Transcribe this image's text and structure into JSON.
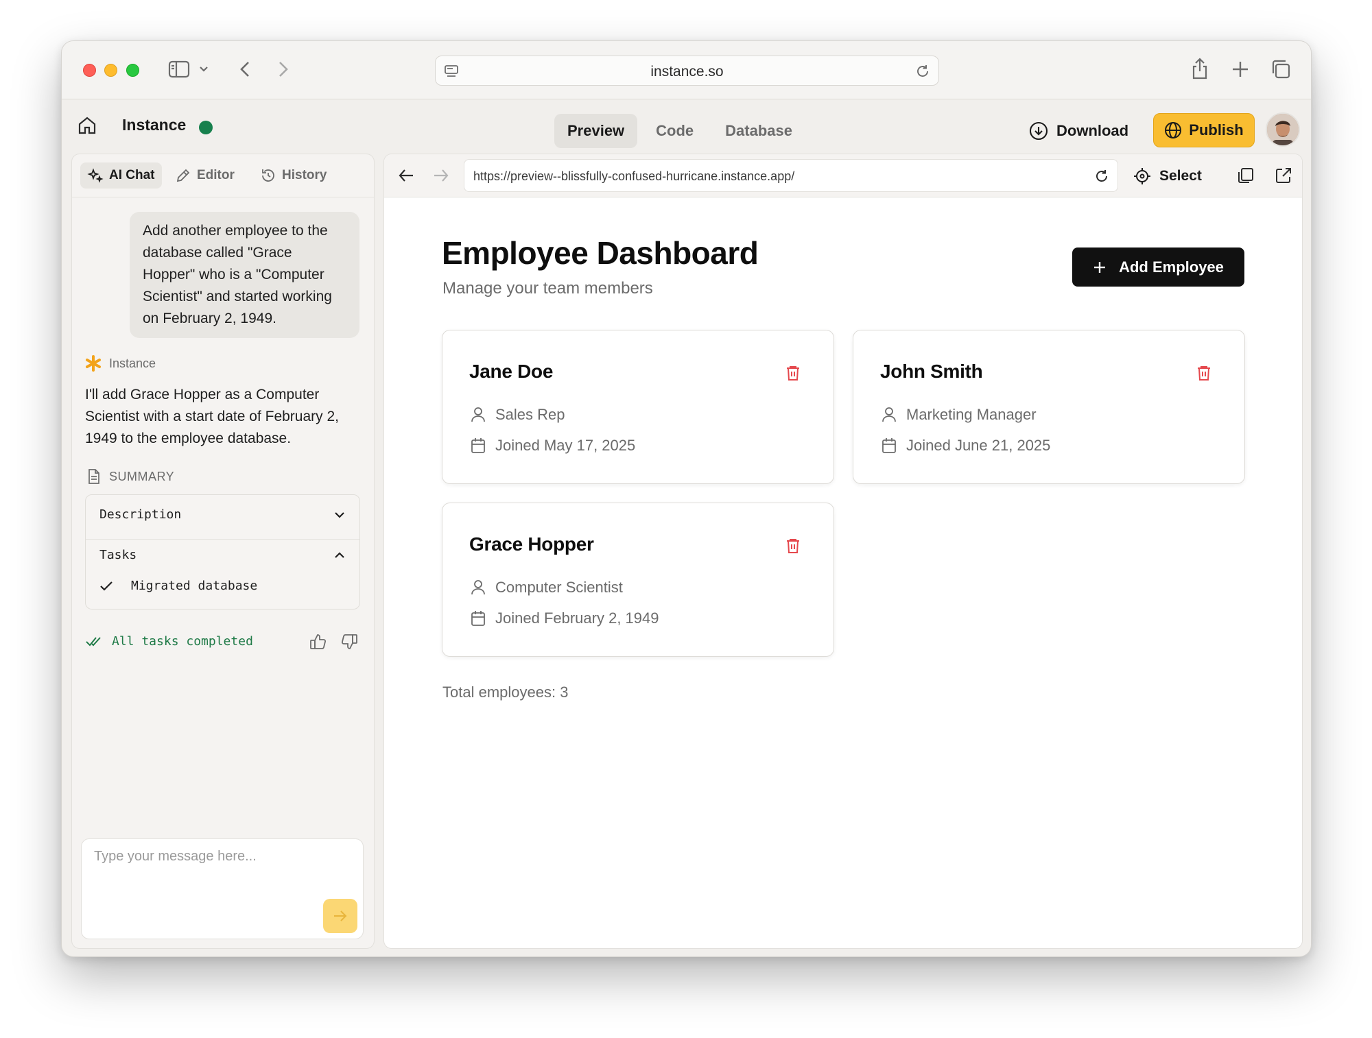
{
  "browser": {
    "url": "instance.so"
  },
  "app": {
    "name": "Instance",
    "tabs": [
      {
        "label": "Preview",
        "active": true
      },
      {
        "label": "Code",
        "active": false
      },
      {
        "label": "Database",
        "active": false
      }
    ],
    "download_label": "Download",
    "publish_label": "Publish",
    "accent_color": "#f9bd31",
    "status_color": "#17804d"
  },
  "chat": {
    "tabs": [
      {
        "label": "AI Chat",
        "icon": "sparkles-icon",
        "active": true
      },
      {
        "label": "Editor",
        "icon": "pencil-icon",
        "active": false
      },
      {
        "label": "History",
        "icon": "history-icon",
        "active": false
      }
    ],
    "user_message": "Add another employee to the database called \"Grace Hopper\" who is a \"Computer Scientist\" and started working on February 2, 1949.",
    "assistant_name": "Instance",
    "assistant_message": "I'll add Grace Hopper as a Computer Scientist with a start date of February 2, 1949 to the employee database.",
    "summary_label": "SUMMARY",
    "description_label": "Description",
    "tasks_label": "Tasks",
    "task_items": [
      "Migrated database"
    ],
    "completed_label": "All tasks completed",
    "input_placeholder": "Type your message here..."
  },
  "preview": {
    "url": "https://preview--blissfully-confused-hurricane.instance.app/",
    "select_label": "Select",
    "title": "Employee Dashboard",
    "subtitle": "Manage your team members",
    "add_button_label": "Add Employee",
    "employees": [
      {
        "name": "Jane Doe",
        "role": "Sales Rep",
        "joined": "Joined May 17, 2025"
      },
      {
        "name": "John Smith",
        "role": "Marketing Manager",
        "joined": "Joined June 21, 2025"
      },
      {
        "name": "Grace Hopper",
        "role": "Computer Scientist",
        "joined": "Joined February 2, 1949"
      }
    ],
    "total_label": "Total employees: 3"
  }
}
